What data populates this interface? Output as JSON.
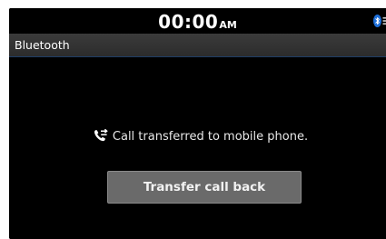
{
  "status_bar": {
    "time": "00:00",
    "ampm": "AM",
    "icons": [
      "bluetooth-icon",
      "phone-signal-icon"
    ]
  },
  "header": {
    "title": "Bluetooth"
  },
  "main": {
    "message_icon": "call-transfer-icon",
    "message": "Call transferred to mobile phone.",
    "transfer_button_label": "Transfer call back"
  },
  "colors": {
    "screen_background": "#000000",
    "title_bar": "#353535",
    "title_bar_underline": "#1f3e66",
    "button": "#6a6a6a",
    "bluetooth_blue": "#1e6fd9"
  }
}
